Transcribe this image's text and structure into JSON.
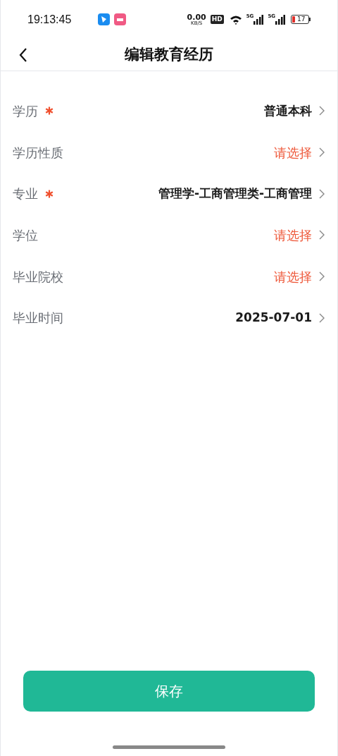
{
  "status_bar": {
    "time": "19:13:45",
    "net_speed": "0.00",
    "net_unit": "KB/S",
    "hd": "HD",
    "signal_1": "5G",
    "signal_2": "5G",
    "battery": "17"
  },
  "header": {
    "title": "编辑教育经历"
  },
  "fields": [
    {
      "label": "学历",
      "required": true,
      "value": "普通本科"
    },
    {
      "label": "学历性质",
      "required": false,
      "placeholder": "请选择"
    },
    {
      "label": "专业",
      "required": true,
      "value": "管理学-工商管理类-工商管理"
    },
    {
      "label": "学位",
      "required": false,
      "placeholder": "请选择"
    },
    {
      "label": "毕业院校",
      "required": false,
      "placeholder": "请选择"
    },
    {
      "label": "毕业时间",
      "required": false,
      "value": "2025-07-01"
    }
  ],
  "save_button": "保存"
}
